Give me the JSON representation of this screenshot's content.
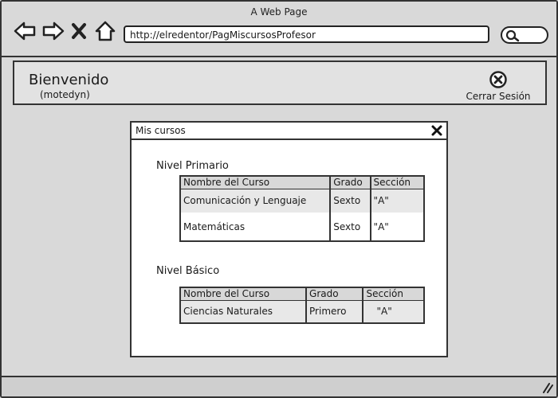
{
  "window": {
    "title": "A Web Page",
    "url": "http://elredentor/PagMiscursosProfesor"
  },
  "header": {
    "welcome": "Bienvenido",
    "username": "(motedyn)",
    "logout_label": "Cerrar Sesión"
  },
  "dialog": {
    "title": "Mis cursos",
    "sections": [
      {
        "title": "Nivel Primario",
        "columns": [
          "Nombre del Curso",
          "Grado",
          "Sección"
        ],
        "rows": [
          [
            "Comunicación y Lenguaje",
            "Sexto",
            "\"A\""
          ],
          [
            "Matemáticas",
            "Sexto",
            "\"A\""
          ]
        ]
      },
      {
        "title": "Nivel Básico",
        "columns": [
          "Nombre del Curso",
          "Grado",
          "Sección"
        ],
        "rows": [
          [
            "Ciencias Naturales",
            "Primero",
            "\"A\""
          ]
        ]
      }
    ]
  }
}
